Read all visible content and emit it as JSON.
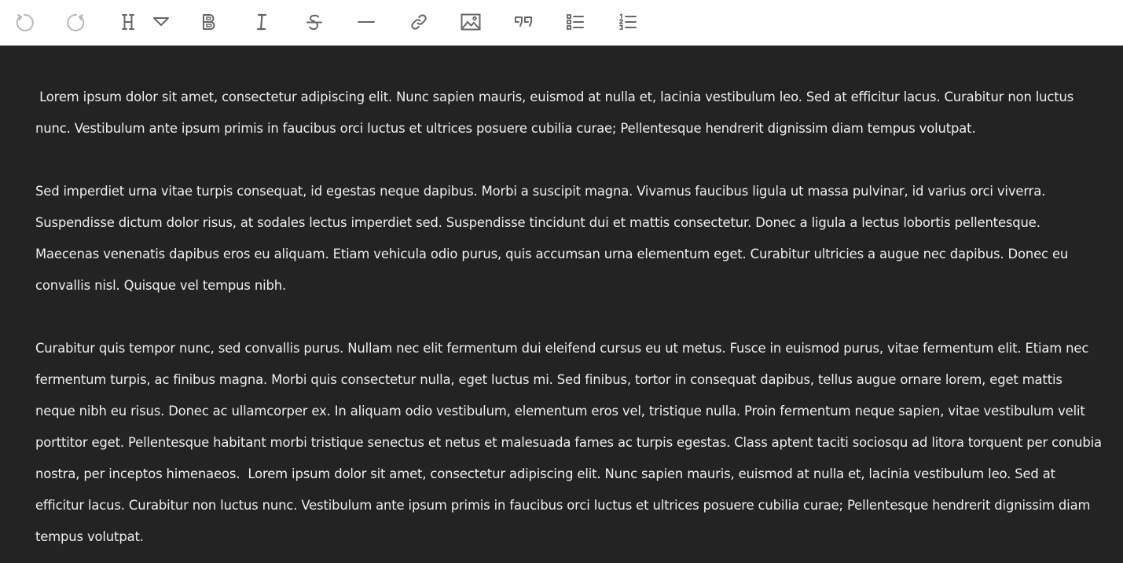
{
  "toolbar": {
    "buttons": [
      {
        "name": "undo",
        "icon": "undo-icon",
        "enabled": false
      },
      {
        "name": "redo",
        "icon": "redo-icon",
        "enabled": false
      },
      {
        "name": "heading",
        "icon": "heading-icon",
        "enabled": true
      },
      {
        "name": "heading-dropdown",
        "icon": "chevron-down-icon",
        "enabled": true
      },
      {
        "name": "bold",
        "icon": "bold-icon",
        "enabled": true
      },
      {
        "name": "italic",
        "icon": "italic-icon",
        "enabled": true
      },
      {
        "name": "strikethrough",
        "icon": "strikethrough-icon",
        "enabled": true
      },
      {
        "name": "horizontal-rule",
        "icon": "horizontal-rule-icon",
        "enabled": true
      },
      {
        "name": "link",
        "icon": "link-icon",
        "enabled": true
      },
      {
        "name": "image",
        "icon": "image-icon",
        "enabled": true
      },
      {
        "name": "blockquote",
        "icon": "quote-icon",
        "enabled": true
      },
      {
        "name": "bullet-list",
        "icon": "bullet-list-icon",
        "enabled": true
      },
      {
        "name": "ordered-list",
        "icon": "ordered-list-icon",
        "enabled": true
      }
    ]
  },
  "editor": {
    "paragraphs": [
      " Lorem ipsum dolor sit amet, consectetur adipiscing elit. Nunc sapien mauris, euismod at nulla et, lacinia vestibulum leo. Sed at efficitur lacus. Curabitur non luctus nunc. Vestibulum ante ipsum primis in faucibus orci luctus et ultrices posuere cubilia curae; Pellentesque hendrerit dignissim diam tempus volutpat.",
      "Sed imperdiet urna vitae turpis consequat, id egestas neque dapibus. Morbi a suscipit magna. Vivamus faucibus ligula ut massa pulvinar, id varius orci viverra. Suspendisse dictum dolor risus, at sodales lectus imperdiet sed. Suspendisse tincidunt dui et mattis consectetur. Donec a ligula a lectus lobortis pellentesque. Maecenas venenatis dapibus eros eu aliquam. Etiam vehicula odio purus, quis accumsan urna elementum eget. Curabitur ultricies a augue nec dapibus. Donec eu convallis nisl. Quisque vel tempus nibh.",
      "Curabitur quis tempor nunc, sed convallis purus. Nullam nec elit fermentum dui eleifend cursus eu ut metus. Fusce in euismod purus, vitae fermentum elit. Etiam nec fermentum turpis, ac finibus magna. Morbi quis consectetur nulla, eget luctus mi. Sed finibus, tortor in consequat dapibus, tellus augue ornare lorem, eget mattis neque nibh eu risus. Donec ac ullamcorper ex. In aliquam odio vestibulum, elementum eros vel, tristique nulla. Proin fermentum neque sapien, vitae vestibulum velit porttitor eget. Pellentesque habitant morbi tristique senectus et netus et malesuada fames ac turpis egestas. Class aptent taciti sociosqu ad litora torquent per conubia nostra, per inceptos himenaeos.  Lorem ipsum dolor sit amet, consectetur adipiscing elit. Nunc sapien mauris, euismod at nulla et, lacinia vestibulum leo. Sed at efficitur lacus. Curabitur non luctus nunc. Vestibulum ante ipsum primis in faucibus orci luctus et ultrices posuere cubilia curae; Pellentesque hendrerit dignissim diam tempus volutpat."
    ]
  },
  "colors": {
    "toolbar_bg": "#ffffff",
    "icon": "#666666",
    "editor_bg": "#232324",
    "text": "#eeeeee"
  }
}
